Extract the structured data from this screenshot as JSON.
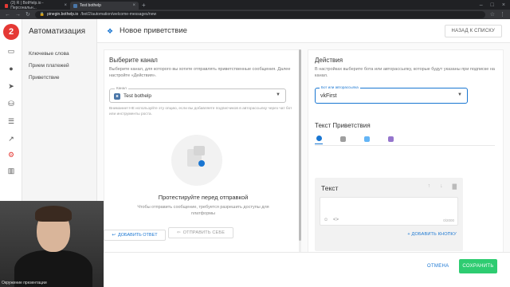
{
  "browser": {
    "tabs": [
      {
        "title": "(3) R | BotHelp.io - Персональн...",
        "active": false,
        "fav_color": "#e53935"
      },
      {
        "title": "Test bothelp",
        "active": true,
        "fav_color": "#4a76a8"
      }
    ],
    "url_host": "pinegin.bothelp.io",
    "url_path": "/bot/2/automation/welcome-messages/new"
  },
  "rail": {
    "logo": "2",
    "icons": [
      "chat-icon",
      "users-icon",
      "send-icon",
      "database-icon",
      "list-icon",
      "chart-icon",
      "automation-icon",
      "stats-icon"
    ],
    "bottom_icons": [
      "help-icon",
      "settings-icon"
    ]
  },
  "subnav": {
    "title": "Автоматизация",
    "items": [
      "Ключевые слова",
      "Прием платежей",
      "Приветствие"
    ]
  },
  "header": {
    "title": "Новое приветствие",
    "back_label": "НАЗАД К СПИСКУ"
  },
  "channel": {
    "title": "Выберите канал",
    "description": "Выберите канал, для которого вы хотите отправлять приветственные сообщения. Далее настройте «Действия».",
    "select_legend": "Канал",
    "select_value": "Test bothelp",
    "warning": "Внимание! НЕ используйте эту опцию, если вы добавляете подписчиков в авторассылку через чат бот или инструменты роста."
  },
  "test": {
    "title": "Протестируйте перед отправкой",
    "description": "Чтобы отправить сообщение, требуется разрешить доступы для платформы",
    "button": "ОТПРАВИТЬ СЕБЕ"
  },
  "actions": {
    "title": "Действия",
    "description": "В настройках выберите бота или авторассылку, которые будут указаны при подписке на канал.",
    "bot_legend": "Бот или авторассылка",
    "bot_value": "vkFirst",
    "greeting_title": "Текст Приветствия",
    "platforms": [
      {
        "name": "messenger-icon",
        "color": "#1976d2",
        "active": true
      },
      {
        "name": "vk-icon",
        "color": "#9e9e9e",
        "active": false
      },
      {
        "name": "telegram-icon",
        "color": "#64b5f6",
        "active": false
      },
      {
        "name": "viber-icon",
        "color": "#9575cd",
        "active": false
      }
    ]
  },
  "message": {
    "title": "Текст",
    "counter": "0/2000",
    "add_button": "ДОБАВИТЬ КНОПКУ",
    "add_answer": "ДОБАВИТЬ ОТВЕТ"
  },
  "footer": {
    "cancel": "ОТМЕНА",
    "save": "СОХРАНИТЬ"
  },
  "webcam": {
    "label": "Окружение презентации"
  },
  "colors": {
    "accent": "#1976d2",
    "brand": "#e53935",
    "save": "#2ecc71"
  }
}
